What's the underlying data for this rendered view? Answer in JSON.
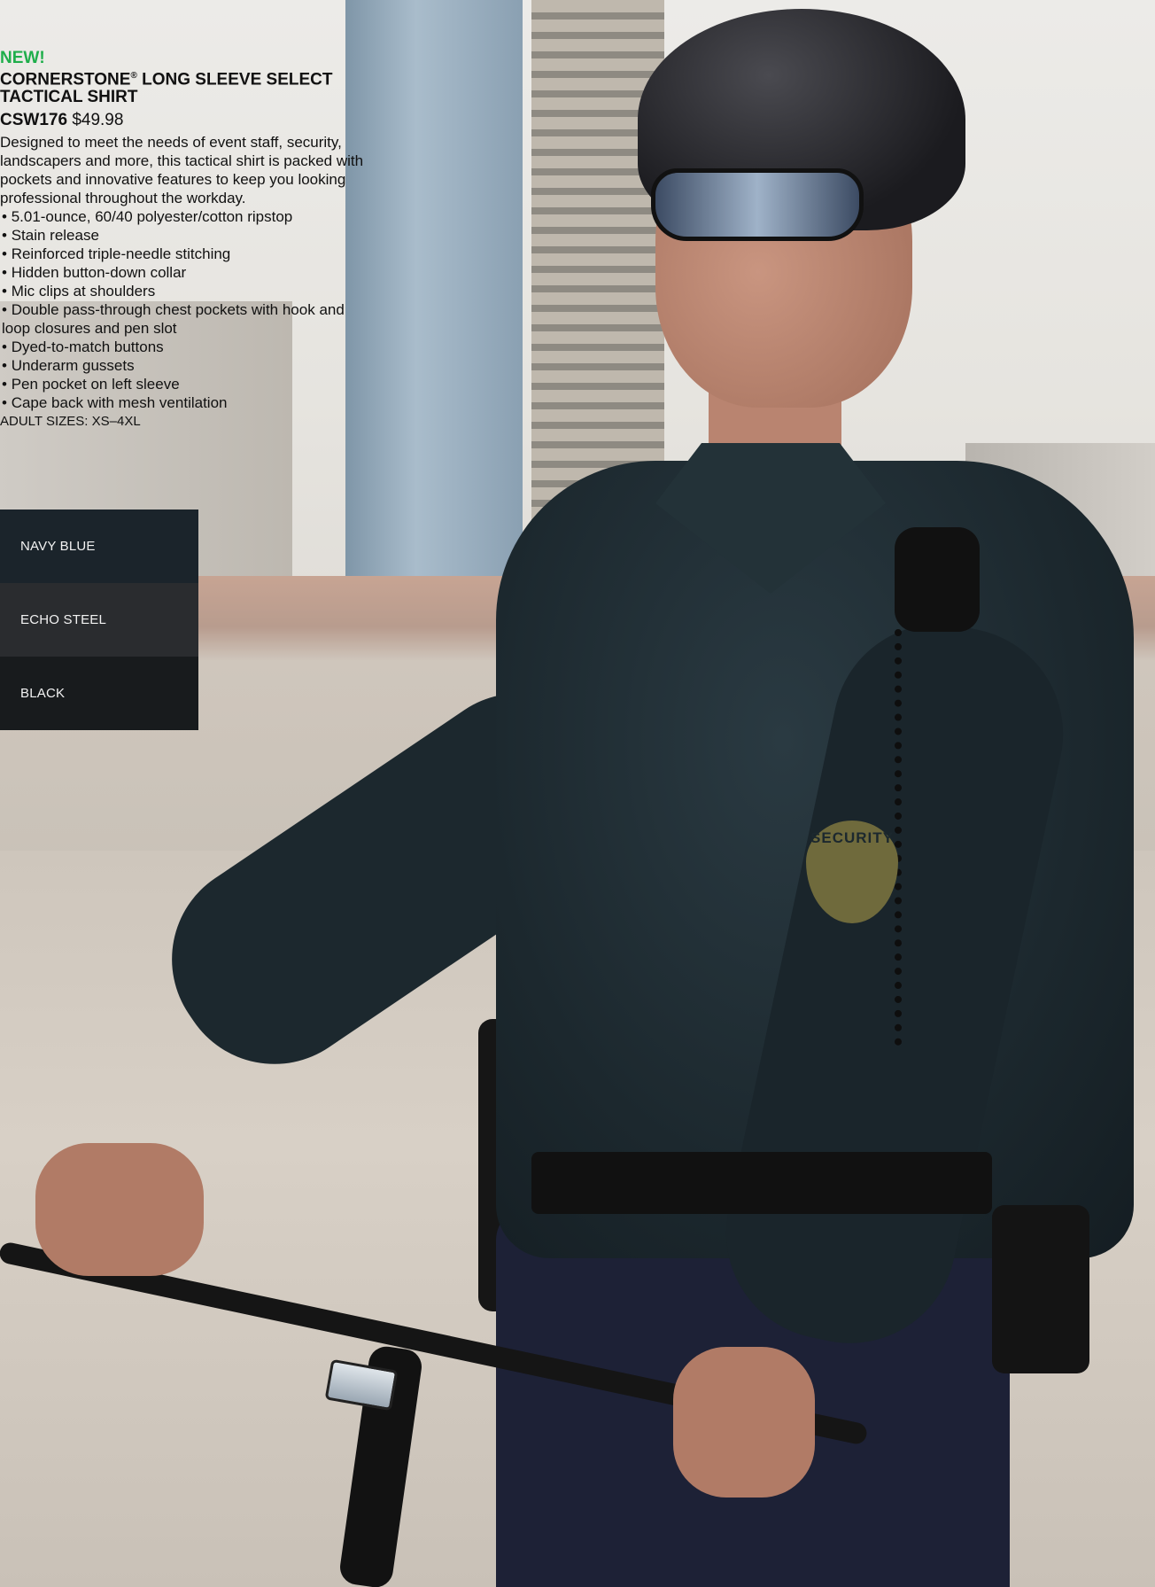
{
  "product": {
    "badge": "NEW!",
    "title": "CORNERSTONE",
    "registered_mark": "®",
    "title_rest": " LONG SLEEVE SELECT TACTICAL SHIRT",
    "sku": "CSW176",
    "price": "$49.98",
    "description": "Designed to meet the needs of event staff, security, landscapers and more, this tactical shirt is packed with pockets and innovative features to keep you looking professional throughout the workday.",
    "features": [
      "5.01-ounce, 60/40 polyester/cotton ripstop",
      "Stain release",
      "Reinforced triple-needle stitching",
      "Hidden button-down collar",
      "Mic clips at shoulders",
      "Double pass-through chest pockets with hook and loop closures and pen slot",
      "Dyed-to-match buttons",
      "Underarm gussets",
      "Pen pocket on left sleeve",
      "Cape back with mesh ventilation"
    ],
    "sizes": "ADULT SIZES: XS–4XL"
  },
  "colors": [
    {
      "label": "NAVY BLUE",
      "hex": "#1b242b"
    },
    {
      "label": "ECHO STEEL",
      "hex": "#2a2c2f"
    },
    {
      "label": "BLACK",
      "hex": "#181b1d"
    }
  ],
  "photo": {
    "badge_text": "SECURITY"
  }
}
